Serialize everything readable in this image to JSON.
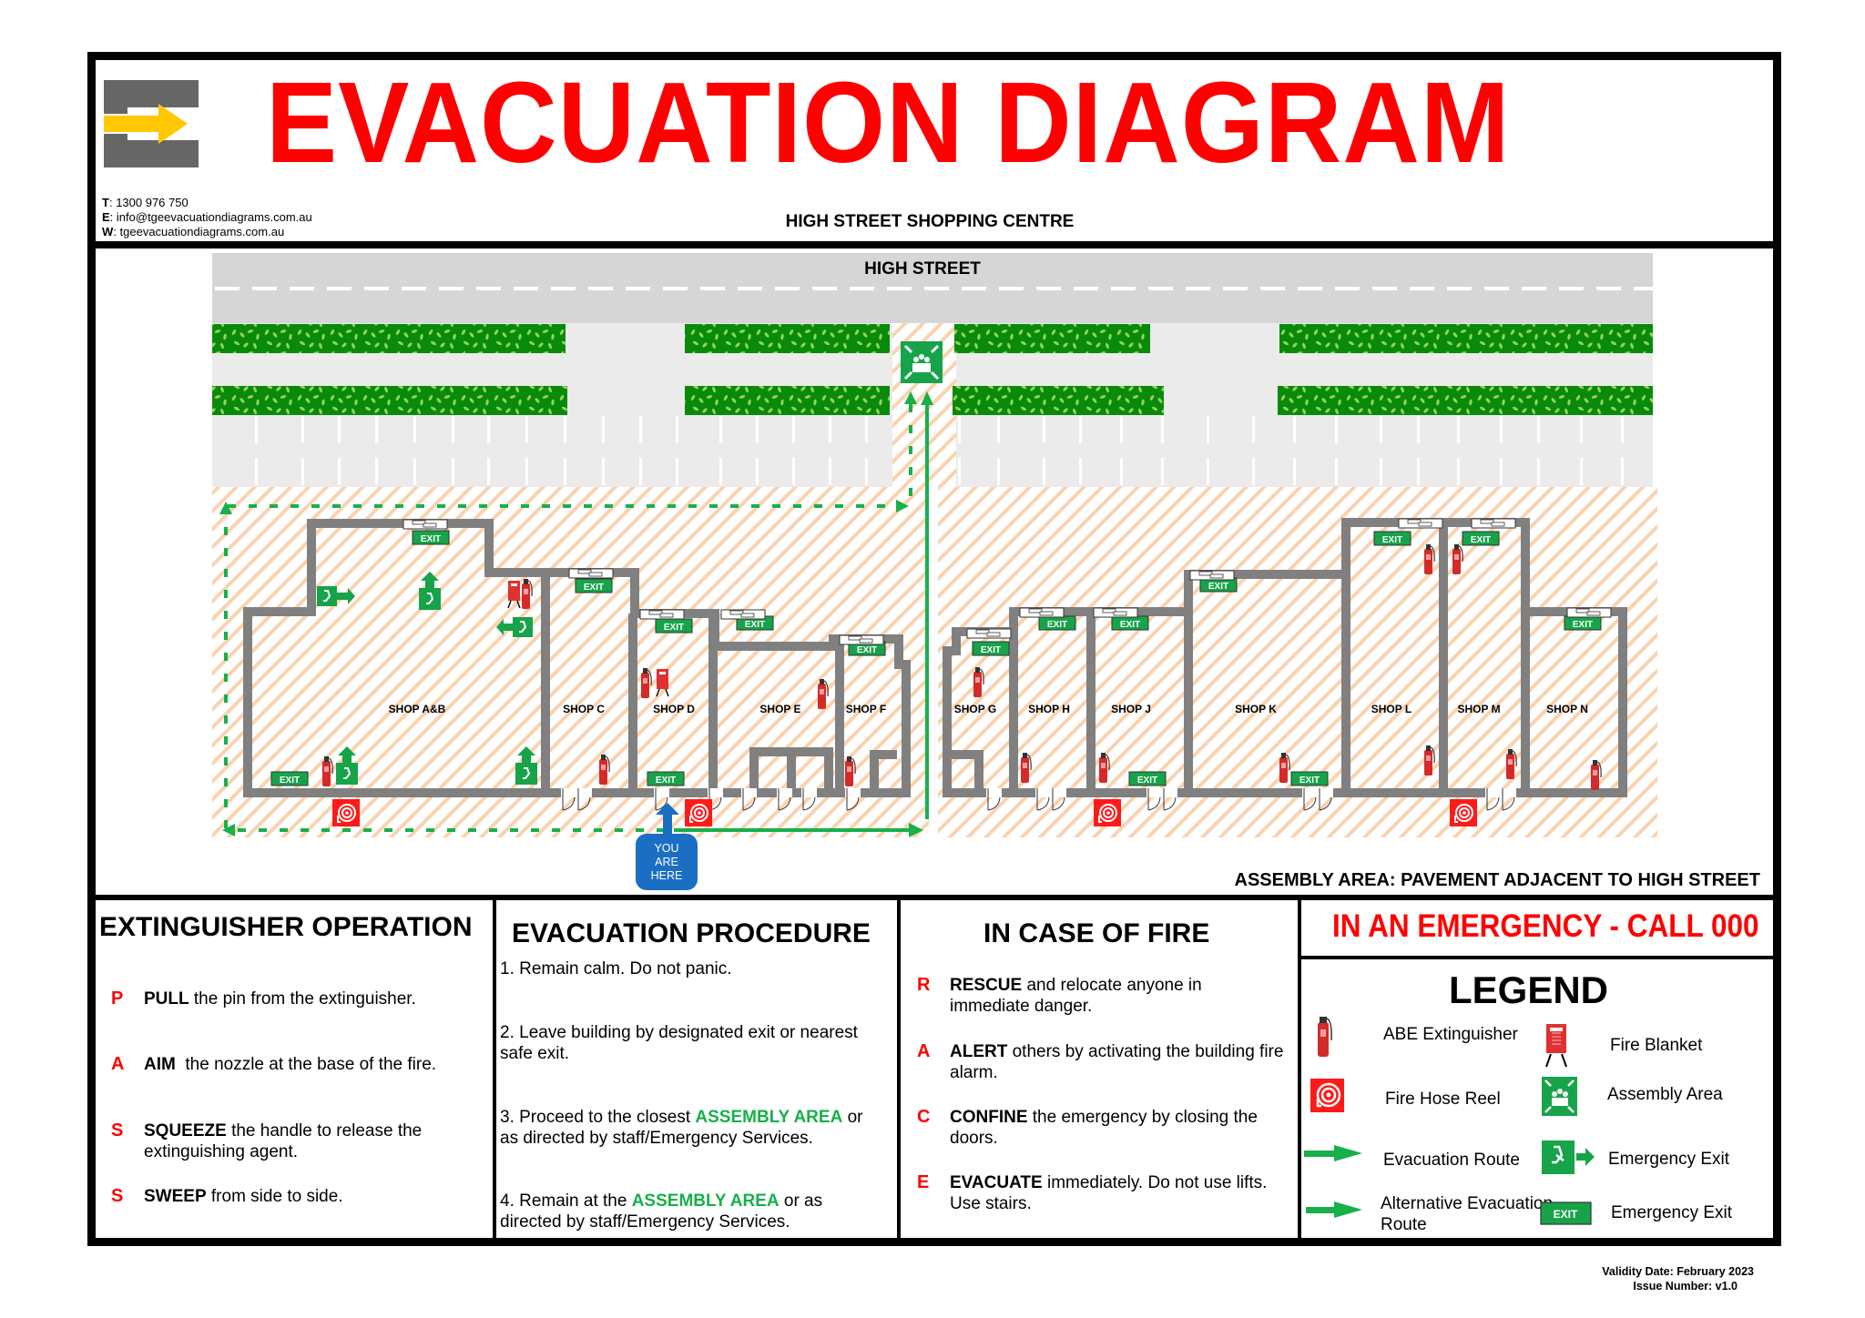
{
  "header": {
    "title": "EVACUATION DIAGRAM",
    "subtitle": "HIGH STREET SHOPPING CENTRE",
    "contact": {
      "phone_label": "T",
      "phone": "1300 976 750",
      "email_label": "E",
      "email": "info@tgeevacuationdiagrams.com.au",
      "web_label": "W",
      "web": "tgeevacuationdiagrams.com.au"
    },
    "logo": "tge-logo-arrow-icon",
    "colors": {
      "title": "#ff0000",
      "logo_grey": "#666666",
      "logo_yellow": "#ffc800"
    }
  },
  "plan": {
    "street_label": "HIGH STREET",
    "exit_sign_text": "EXIT",
    "you_are_here": [
      "YOU",
      "ARE",
      "HERE"
    ],
    "assembly_note": "ASSEMBLY AREA: PAVEMENT ADJACENT TO HIGH STREET",
    "shops": [
      "SHOP A&B",
      "SHOP C",
      "SHOP D",
      "SHOP E",
      "SHOP F",
      "SHOP G",
      "SHOP H",
      "SHOP J",
      "SHOP K",
      "SHOP L",
      "SHOP M",
      "SHOP N"
    ],
    "colors": {
      "wall": "#808080",
      "route": "#17b04a",
      "hedge": "#0a8a0a",
      "road": "#d6d6d6",
      "carpark": "#ebebeb",
      "hatch": "#f7c8a0",
      "you_are_here": "#1a6fc4",
      "hose_reel": "#ff1a1a"
    }
  },
  "extinguisher": {
    "title": "EXTINGUISHER OPERATION",
    "steps": [
      {
        "letter": "P",
        "keyword": "PULL",
        "text": " the pin from the extinguisher."
      },
      {
        "letter": "A",
        "keyword": "AIM",
        "text": "  the nozzle at the base of the fire."
      },
      {
        "letter": "S",
        "keyword": "SQUEEZE",
        "text": " the handle to release the extinguishing agent."
      },
      {
        "letter": "S",
        "keyword": "SWEEP",
        "text": " from side to side."
      }
    ]
  },
  "procedure": {
    "title": "EVACUATION PROCEDURE",
    "steps": [
      {
        "pre": "1. Remain calm. Do not panic.",
        "hl": "",
        "post": ""
      },
      {
        "pre": "2. Leave building by designated exit or nearest safe exit.",
        "hl": "",
        "post": ""
      },
      {
        "pre": "3. Proceed to the closest ",
        "hl": "ASSEMBLY AREA",
        "post": " or as directed by staff/Emergency Services."
      },
      {
        "pre": "4. Remain at the ",
        "hl": "ASSEMBLY AREA",
        "post": " or as directed by staff/Emergency Services."
      }
    ]
  },
  "fire": {
    "title": "IN CASE OF FIRE",
    "steps": [
      {
        "letter": "R",
        "keyword": "RESCUE",
        "text": " and relocate anyone in immediate danger."
      },
      {
        "letter": "A",
        "keyword": "ALERT",
        "text": " others by activating the building fire alarm."
      },
      {
        "letter": "C",
        "keyword": "CONFINE",
        "text": " the emergency by closing the doors."
      },
      {
        "letter": "E",
        "keyword": "EVACUATE",
        "text": " immediately. Do not use lifts. Use stairs."
      }
    ]
  },
  "emergency": {
    "text": "IN AN EMERGENCY - CALL 000"
  },
  "legend": {
    "title": "LEGEND",
    "items": [
      {
        "icon": "extinguisher-icon",
        "label": "ABE Extinguisher"
      },
      {
        "icon": "fire-blanket-icon",
        "label": "Fire Blanket"
      },
      {
        "icon": "fire-hose-reel-icon",
        "label": "Fire Hose Reel"
      },
      {
        "icon": "assembly-area-icon",
        "label": "Assembly Area"
      },
      {
        "icon": "evacuation-route-arrow-icon",
        "label": "Evacuation Route"
      },
      {
        "icon": "emergency-exit-running-man-icon",
        "label": "Emergency Exit"
      },
      {
        "icon": "alternative-route-arrow-icon",
        "label": "Alternative Evacuation Route"
      },
      {
        "icon": "exit-sign-icon",
        "label": "Emergency Exit"
      }
    ]
  },
  "footer": {
    "validity": "Validity Date: February 2023",
    "issue": "Issue Number: v1.0"
  }
}
